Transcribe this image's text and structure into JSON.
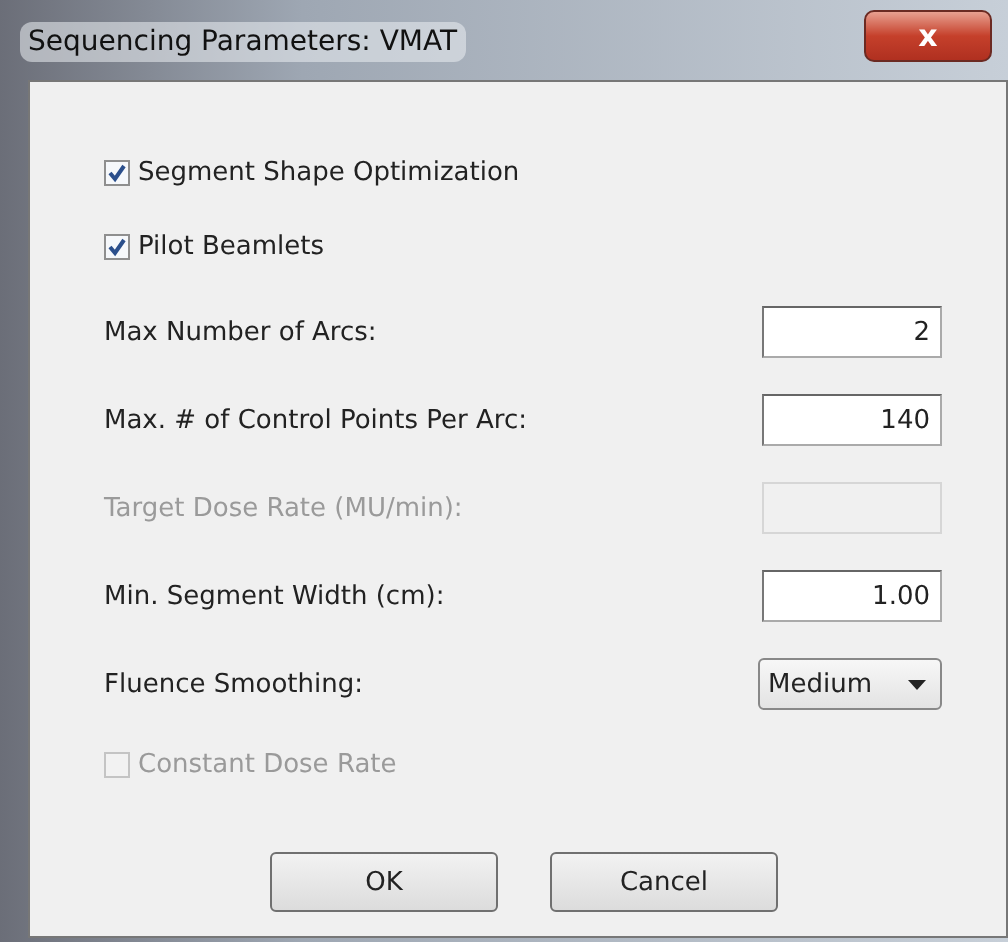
{
  "window": {
    "title": "Sequencing Parameters: VMAT",
    "close": "x"
  },
  "items": [
    {
      "kind": "checkbox",
      "label": "Segment Shape Optimization",
      "checked": true,
      "disabled": false
    },
    {
      "kind": "checkbox",
      "label": "Pilot Beamlets",
      "checked": true,
      "disabled": false
    },
    {
      "kind": "field",
      "label": "Max Number of Arcs:",
      "value": "2",
      "disabled": false
    },
    {
      "kind": "field",
      "label": "Max. # of Control Points Per Arc:",
      "value": "140",
      "disabled": false
    },
    {
      "kind": "field",
      "label": "Target Dose Rate (MU/min):",
      "disabled": true
    },
    {
      "kind": "field",
      "label": "Min. Segment Width (cm):",
      "value": "1.00",
      "disabled": false
    },
    {
      "kind": "dropdown",
      "label": "Fluence Smoothing:",
      "value": "Medium"
    },
    {
      "kind": "checkbox",
      "label": "Constant Dose Rate",
      "checked": false,
      "disabled": true
    }
  ],
  "buttons": [
    "OK",
    "Cancel"
  ]
}
